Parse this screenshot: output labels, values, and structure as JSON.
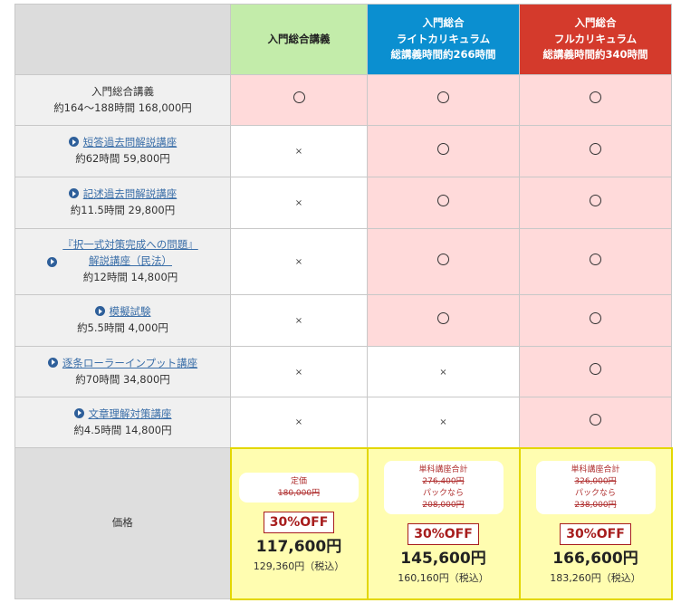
{
  "columns": [
    {
      "lines": [
        "入門総合講義"
      ]
    },
    {
      "lines": [
        "入門総合",
        "ライトカリキュラム",
        "総講義時間約266時間"
      ]
    },
    {
      "lines": [
        "入門総合",
        "フルカリキュラム",
        "総講義時間約340時間"
      ]
    }
  ],
  "rows": [
    {
      "title": "入門総合講義",
      "detail": "約164～188時間 168,000円",
      "marks": [
        "○",
        "○",
        "○"
      ]
    },
    {
      "title": "短答過去問解説講座",
      "detail": "約62時間 59,800円",
      "marks": [
        "×",
        "○",
        "○"
      ]
    },
    {
      "title": "記述過去問解説講座",
      "detail": "約11.5時間 29,800円",
      "marks": [
        "×",
        "○",
        "○"
      ]
    },
    {
      "title_line1": "『択一式対策完成への問題』",
      "title_line2": "解説講座（民法）",
      "detail": "約12時間 14,800円",
      "marks": [
        "×",
        "○",
        "○"
      ]
    },
    {
      "title": "模擬試験",
      "detail": "約5.5時間 4,000円",
      "marks": [
        "×",
        "○",
        "○"
      ]
    },
    {
      "title": "逐条ローラーインプット講座",
      "detail": "約70時間 34,800円",
      "marks": [
        "×",
        "×",
        "○"
      ]
    },
    {
      "title": "文章理解対策講座",
      "detail": "約4.5時間 14,800円",
      "marks": [
        "×",
        "×",
        "○"
      ]
    }
  ],
  "price": {
    "label": "価格",
    "cells": [
      {
        "box": [
          "定価"
        ],
        "box_strike": "180,000円",
        "box_after": [],
        "discount": "30%OFF",
        "price": "117,600円",
        "tax": "129,360円（税込）"
      },
      {
        "box": [
          "単科講座合計"
        ],
        "box_strike": "276,400円",
        "box_after": [
          "パックなら",
          "208,000円"
        ],
        "discount": "30%OFF",
        "price": "145,600円",
        "tax": "160,160円（税込）"
      },
      {
        "box": [
          "単科講座合計"
        ],
        "box_strike": "326,000円",
        "box_after": [
          "パックなら",
          "238,000円"
        ],
        "discount": "30%OFF",
        "price": "166,600円",
        "tax": "183,260円（税込）"
      }
    ]
  },
  "colors": {
    "header_green": "#c3ecaa",
    "header_blue": "#0b8fd0",
    "header_red": "#d43a2c",
    "included_pink": "#ffdada",
    "price_yellow": "#fffdb0",
    "price_border": "#e3d700",
    "discount_red": "#a71d1d",
    "link_blue": "#3a6ea8"
  },
  "icons": {
    "included": "circle-icon",
    "excluded": "cross-icon",
    "link_marker": "play-icon"
  }
}
